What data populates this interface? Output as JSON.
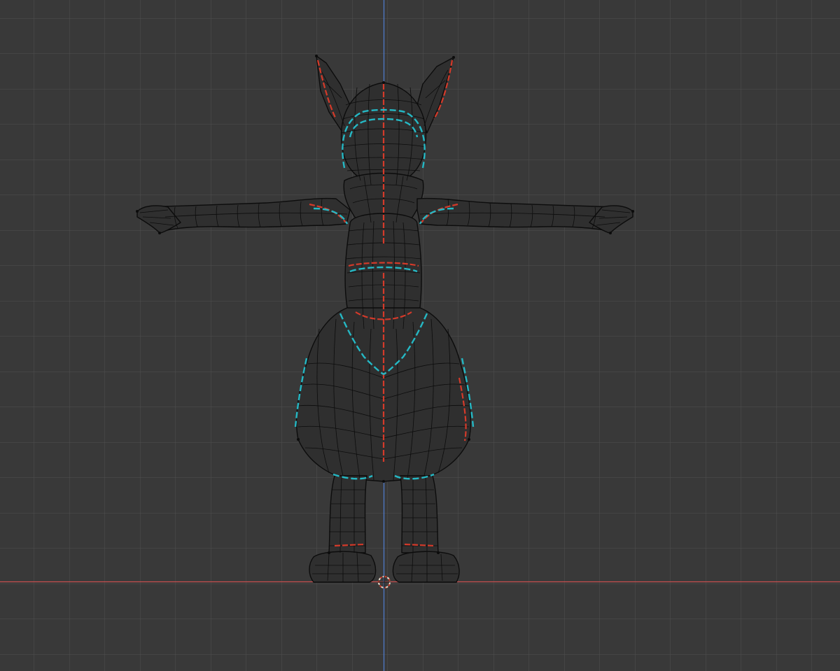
{
  "viewport": {
    "mode": "front-orthographic-wireframe",
    "background_color": "#393939",
    "grid_color": "#4f4f4f",
    "x_axis_color": "#c84f4f",
    "z_axis_color": "#4f7ac8",
    "wire_color": "#0c0c0c",
    "seam_color": "#d43a2a",
    "sharp_edge_color": "#25b8c4",
    "cursor_color": "#e8e0d0",
    "cursor_accent_color": "#d03a2a"
  },
  "scene": {
    "object": "character-mesh",
    "pose": "t-pose",
    "features": [
      "ears",
      "head",
      "neck-fluff",
      "arms",
      "hands",
      "torso",
      "hips",
      "thighs",
      "legs",
      "paws"
    ]
  }
}
